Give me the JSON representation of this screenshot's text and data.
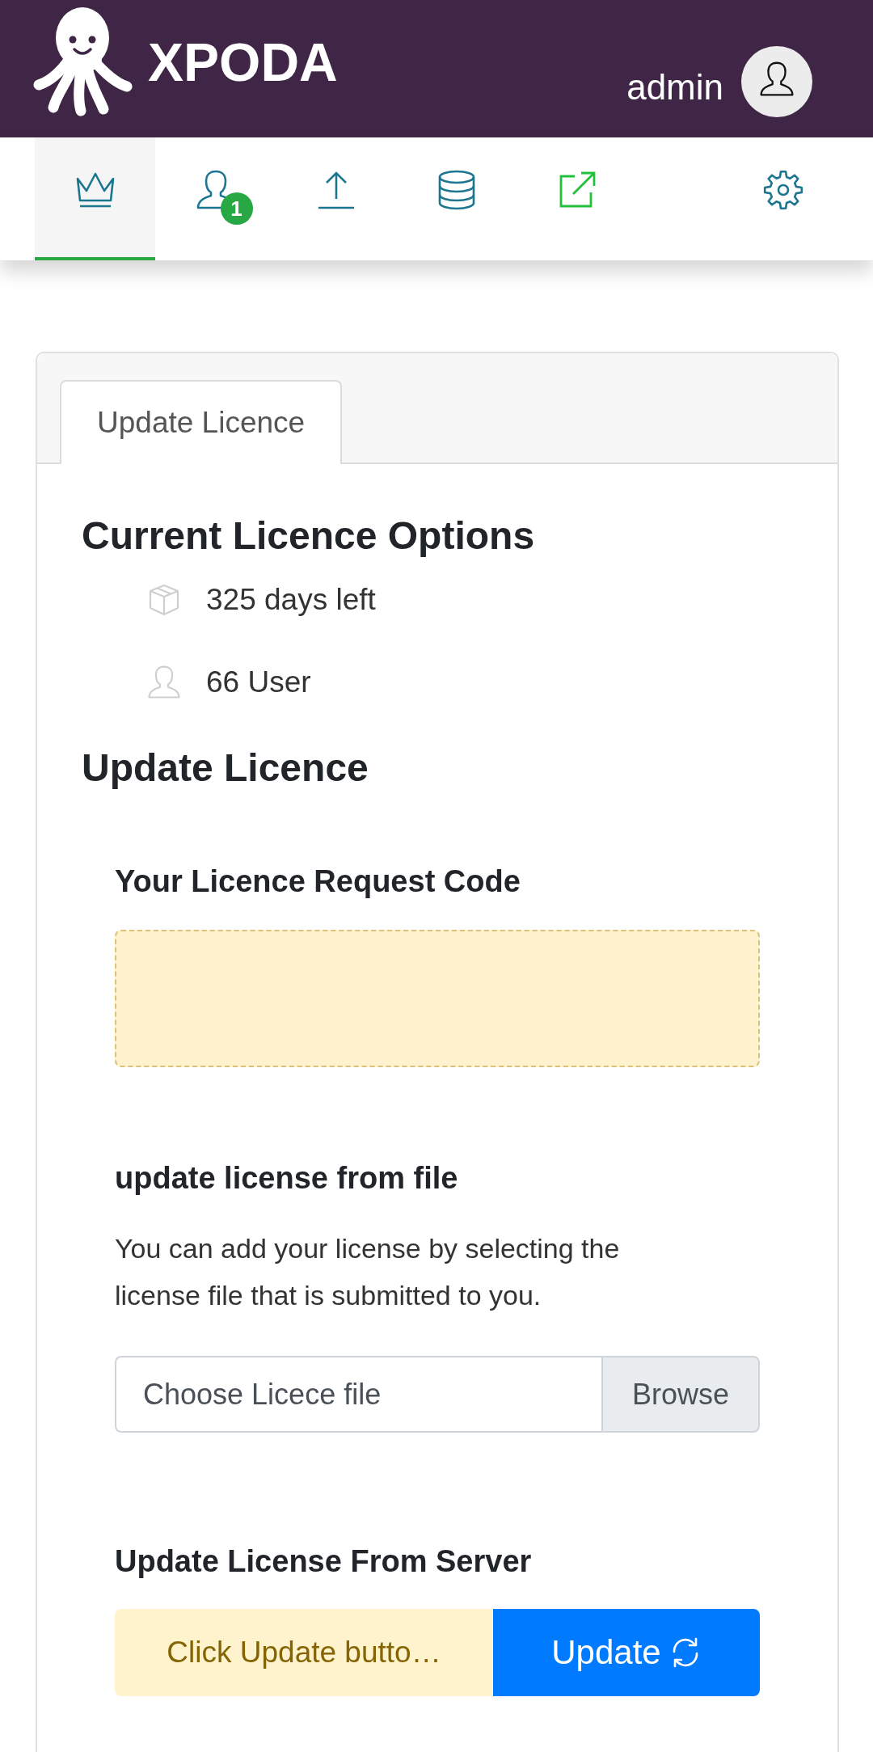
{
  "header": {
    "logo_text": "XPODA",
    "username": "admin"
  },
  "nav": {
    "items": [
      {
        "kind": "crown",
        "selected": true
      },
      {
        "kind": "user",
        "selected": false,
        "badge": "1"
      },
      {
        "kind": "upload",
        "selected": false
      },
      {
        "kind": "database",
        "selected": false
      },
      {
        "kind": "external-link",
        "selected": false
      },
      {
        "kind": "gear",
        "selected": false
      }
    ]
  },
  "card": {
    "tabs": [
      {
        "label": "Update Licence",
        "selected": true
      }
    ],
    "current_options": {
      "title": "Current Licence Options",
      "items": [
        {
          "kind": "package",
          "text": "325 days left"
        },
        {
          "kind": "user",
          "text": "66 User"
        }
      ]
    },
    "update_licence": {
      "title": "Update Licence",
      "request_code": {
        "label": "Your Licence Request Code"
      },
      "from_file": {
        "title": "update license from file",
        "description": "You can add your license by selecting the license file that is submitted to you.",
        "placeholder": "Choose Licece file",
        "button": "Browse"
      },
      "from_server": {
        "title": "Update License From Server",
        "status": "Click Update butto…",
        "button": "Update"
      }
    }
  }
}
